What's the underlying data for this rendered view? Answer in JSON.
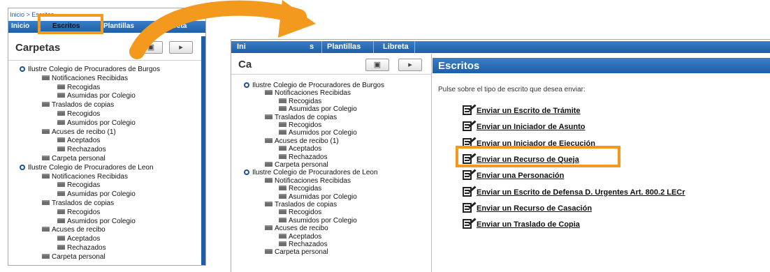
{
  "left": {
    "breadcrumb": "Inicio > Escritos",
    "nav": [
      "Inicio",
      "Escritos",
      "Plantillas",
      "Libreta"
    ],
    "panel_title": "Carpetas",
    "tree": [
      {
        "level": 0,
        "text": "Ilustre Colegio de Procuradores de Burgos"
      },
      {
        "level": 1,
        "text": "Notificaciones Recibidas"
      },
      {
        "level": 2,
        "text": "Recogidas"
      },
      {
        "level": 2,
        "text": "Asumidas por Colegio"
      },
      {
        "level": 1,
        "text": "Traslados de copias"
      },
      {
        "level": 2,
        "text": "Recogidos"
      },
      {
        "level": 2,
        "text": "Asumidos por Colegio"
      },
      {
        "level": 1,
        "text": "Acuses de recibo (1)"
      },
      {
        "level": 2,
        "text": "Aceptados"
      },
      {
        "level": 2,
        "text": "Rechazados"
      },
      {
        "level": 1,
        "text": "Carpeta personal"
      },
      {
        "level": 0,
        "text": "Ilustre Colegio de Procuradores de Leon"
      },
      {
        "level": 1,
        "text": "Notificaciones Recibidas"
      },
      {
        "level": 2,
        "text": "Recogidas"
      },
      {
        "level": 2,
        "text": "Asumidas por Colegio"
      },
      {
        "level": 1,
        "text": "Traslados de copias"
      },
      {
        "level": 2,
        "text": "Recogidos"
      },
      {
        "level": 2,
        "text": "Asumidos por Colegio"
      },
      {
        "level": 1,
        "text": "Acuses de recibo"
      },
      {
        "level": 2,
        "text": "Aceptados"
      },
      {
        "level": 2,
        "text": "Rechazados"
      },
      {
        "level": 1,
        "text": "Carpeta personal"
      }
    ]
  },
  "right": {
    "nav": [
      "Ini",
      "s",
      "Plantillas",
      "Libreta"
    ],
    "left_title": "Ca",
    "header_title": "Escritos",
    "instruction": "Pulse sobre el tipo de escrito que desea enviar:",
    "links": [
      "Enviar un Escrito de Trámite",
      "Enviar un Iniciador de Asunto",
      "Enviar un Iniciador de Ejecución",
      "Enviar un Recurso de Queja",
      "Enviar una Personación",
      "Enviar un Escrito de Defensa D. Urgentes Art. 800.2 LECr",
      "Enviar un Recurso de Casación",
      "Enviar un Traslado de Copia"
    ],
    "tree": [
      {
        "level": 0,
        "text": "Ilustre Colegio de Procuradores de Burgos"
      },
      {
        "level": 1,
        "text": "Notificaciones Recibidas"
      },
      {
        "level": 2,
        "text": "Recogidas"
      },
      {
        "level": 2,
        "text": "Asumidas por Colegio"
      },
      {
        "level": 1,
        "text": "Traslados de copias"
      },
      {
        "level": 2,
        "text": "Recogidos"
      },
      {
        "level": 2,
        "text": "Asumidos por Colegio"
      },
      {
        "level": 1,
        "text": "Acuses de recibo (1)"
      },
      {
        "level": 2,
        "text": "Aceptados"
      },
      {
        "level": 2,
        "text": "Rechazados"
      },
      {
        "level": 1,
        "text": "Carpeta personal"
      },
      {
        "level": 0,
        "text": "Ilustre Colegio de Procuradores de Leon"
      },
      {
        "level": 1,
        "text": "Notificaciones Recibidas"
      },
      {
        "level": 2,
        "text": "Recogidas"
      },
      {
        "level": 2,
        "text": "Asumidas por Colegio"
      },
      {
        "level": 1,
        "text": "Traslados de copias"
      },
      {
        "level": 2,
        "text": "Recogidos"
      },
      {
        "level": 2,
        "text": "Asumidos por Colegio"
      },
      {
        "level": 1,
        "text": "Acuses de recibo"
      },
      {
        "level": 2,
        "text": "Aceptados"
      },
      {
        "level": 2,
        "text": "Rechazados"
      },
      {
        "level": 1,
        "text": "Carpeta personal"
      }
    ]
  },
  "colors": {
    "nav_blue": "#1d5ea8",
    "highlight_orange": "#f39a1e",
    "link_text": "#111111"
  },
  "icons": [
    "circle-bullet-icon",
    "folder-icon",
    "search-folder-icon",
    "move-folder-icon",
    "write-document-icon",
    "curved-arrow-icon"
  ]
}
